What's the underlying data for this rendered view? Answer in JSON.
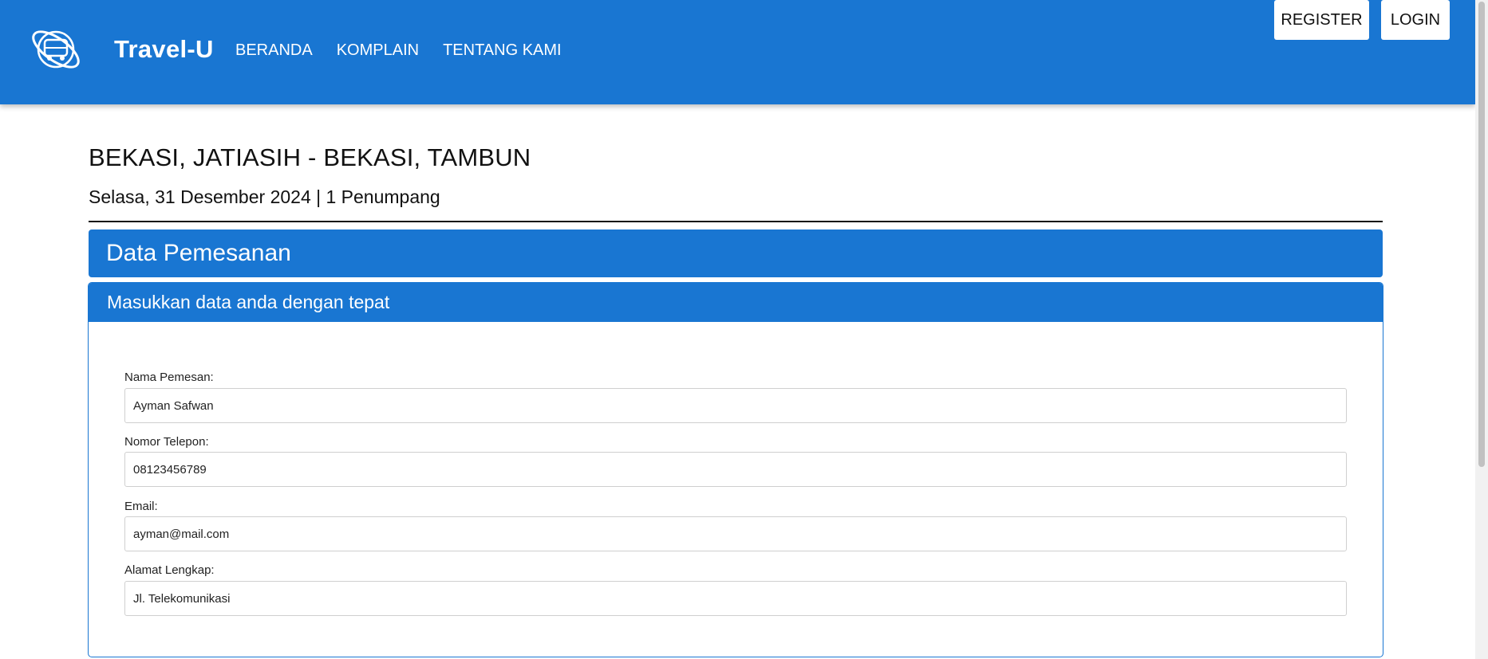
{
  "navbar": {
    "logo_icon": "globe-bus-logo-icon",
    "brand": "Travel-U",
    "links": [
      "BERANDA",
      "KOMPLAIN",
      "TENTANG KAMI"
    ],
    "register_label": "REGISTER",
    "login_label": "LOGIN",
    "color": "#1976d2"
  },
  "trip": {
    "route": "BEKASI, JATIASIH - BEKASI, TAMBUN",
    "info": "Selasa, 31 Desember 2024 | 1 Penumpang"
  },
  "section": {
    "title": "Data Pemesanan"
  },
  "form": {
    "header": "Masukkan data anda dengan tepat",
    "fields": [
      {
        "label": "Nama Pemesan:",
        "value": "Ayman Safwan"
      },
      {
        "label": "Nomor Telepon:",
        "value": "08123456789"
      },
      {
        "label": "Email:",
        "value": "ayman@mail.com"
      },
      {
        "label": "Alamat Lengkap:",
        "value": "Jl. Telekomunikasi"
      }
    ]
  }
}
